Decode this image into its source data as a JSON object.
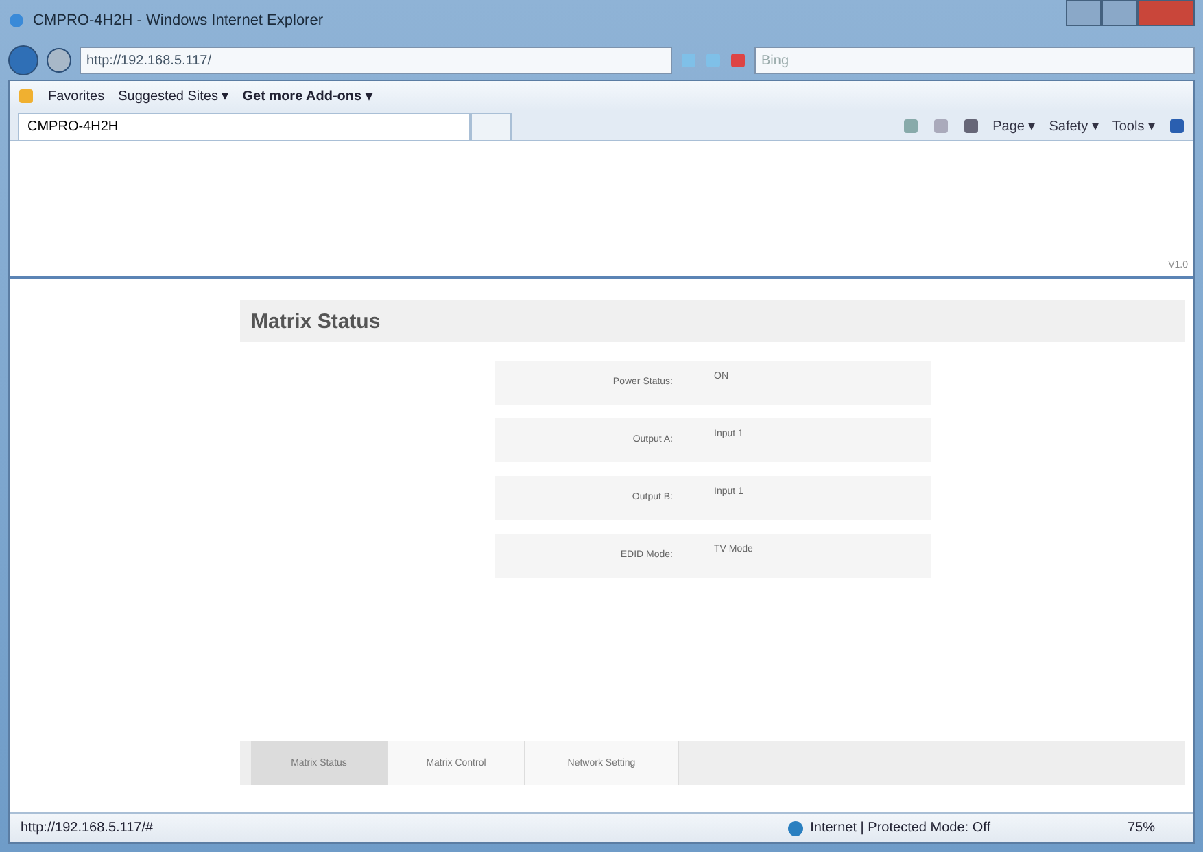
{
  "window": {
    "title": "CMPRO-4H2H - Windows Internet Explorer"
  },
  "address_bar": {
    "url": "http://192.168.5.117/"
  },
  "search": {
    "placeholder": "Bing"
  },
  "favorites_bar": {
    "favorites": "Favorites",
    "links": [
      {
        "label": "Suggested Sites ▾",
        "bold": false
      },
      {
        "label": "Get more Add-ons ▾",
        "bold": true
      }
    ]
  },
  "browser_tab": {
    "title": "CMPRO-4H2H"
  },
  "command_bar": [
    "Page ▾",
    "Safety ▾",
    "Tools ▾"
  ],
  "page": {
    "version": "V1.0",
    "panel_title": "Matrix Status",
    "rows": [
      {
        "label": "Power Status:",
        "value": "ON"
      },
      {
        "label": "Output A:",
        "value": "Input 1"
      },
      {
        "label": "Output B:",
        "value": "Input 1"
      },
      {
        "label": "EDID Mode:",
        "value": "TV Mode"
      }
    ],
    "tabs": [
      {
        "label": "Matrix Status",
        "selected": true
      },
      {
        "label": "Matrix Control",
        "selected": false
      },
      {
        "label": "Network Setting",
        "selected": false
      }
    ]
  },
  "status_bar": {
    "url": "http://192.168.5.117/#",
    "zone": "Internet | Protected Mode: Off",
    "zoom": "75%"
  }
}
